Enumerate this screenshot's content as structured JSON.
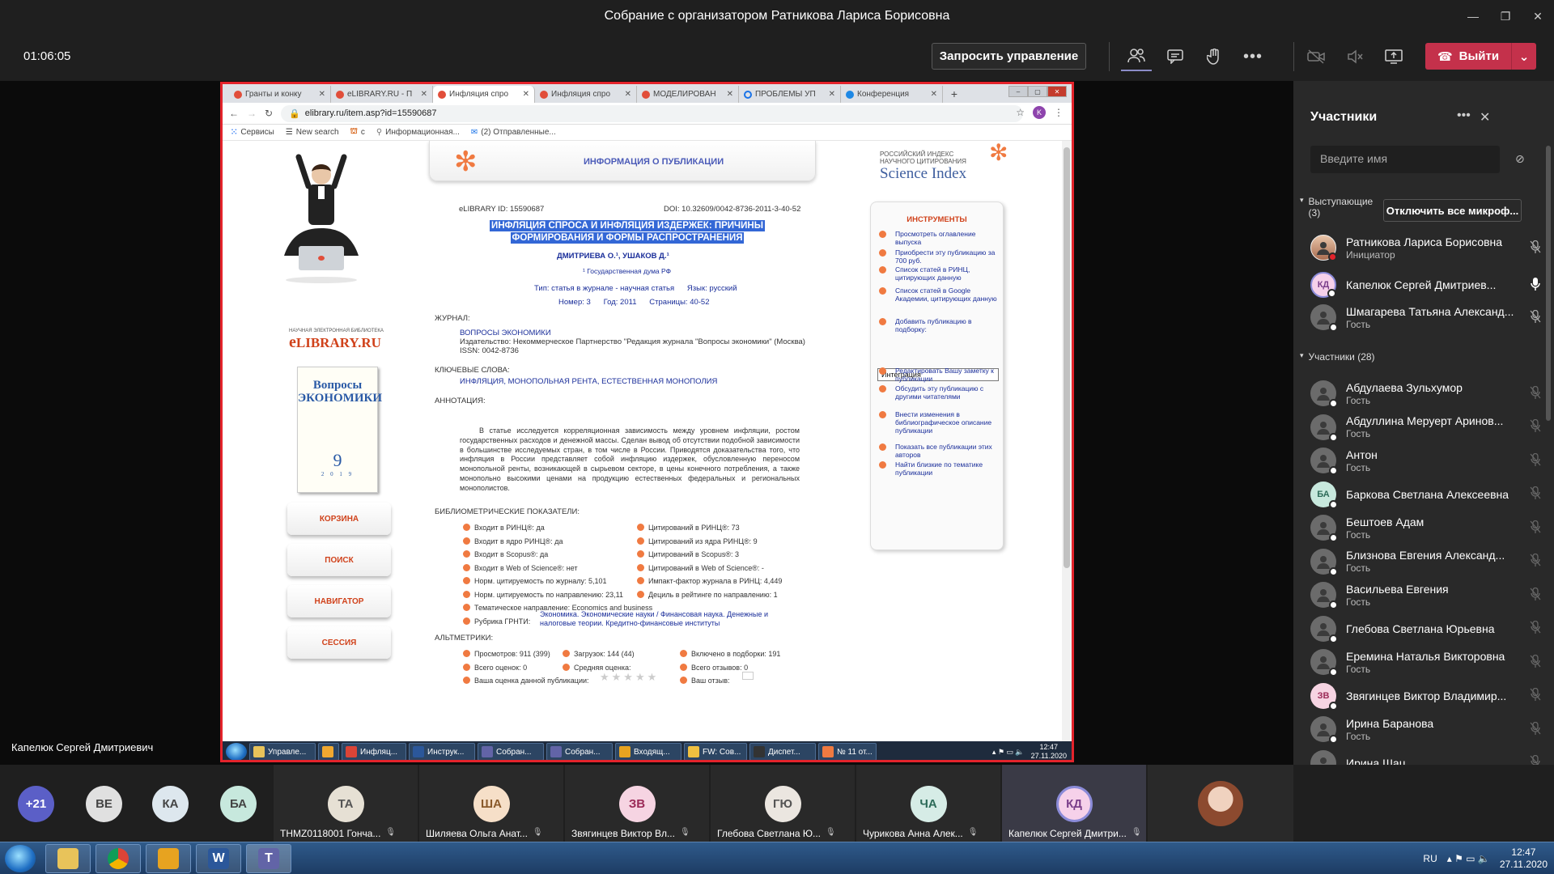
{
  "window": {
    "title": "Собрание с организатором Ратникова Лариса Борисовна"
  },
  "toolbar": {
    "timer": "01:06:05",
    "request_control": "Запросить управление",
    "leave": "Выйти"
  },
  "browser": {
    "tabs": [
      "Гранты и конку",
      "eLIBRARY.RU - П",
      "Инфляция спро",
      "Инфляция спро",
      "МОДЕЛИРОВАН",
      "ПРОБЛЕМЫ УП",
      "Конференция"
    ],
    "active_tab": 2,
    "url": "elibrary.ru/item.asp?id=15590687",
    "profile_initial": "K",
    "bookmarks": [
      "Сервисы",
      "New search",
      "с",
      "Информационная...",
      "(2) Отправленные..."
    ]
  },
  "page": {
    "header": "ИНФОРМАЦИЯ О ПУБЛИКАЦИИ",
    "elibrary_id": "eLIBRARY ID: 15590687",
    "doi": "DOI: 10.32609/0042-8736-2011-3-40-52",
    "title_line1": "ИНФЛЯЦИЯ СПРОСА И ИНФЛЯЦИЯ ИЗДЕРЖЕК: ПРИЧИНЫ",
    "title_line2": "ФОРМИРОВАНИЯ И ФОРМЫ РАСПРОСТРАНЕНИЯ",
    "authors": "ДМИТРИЕВА О.¹, УШАКОВ Д.¹",
    "affiliation": "¹ Государственная дума РФ",
    "type_line": "Тип: статья в журнале - научная статья      Язык: русский",
    "issue_line": "Номер: 3      Год: 2011      Страницы: 40-52",
    "journal_label": "ЖУРНАЛ:",
    "journal_name": "ВОПРОСЫ ЭКОНОМИКИ",
    "publisher": "Издательство: Некоммерческое Партнерство \"Редакция журнала \"Вопросы экономики\" (Москва)",
    "issn": "ISSN: 0042-8736",
    "keywords_label": "КЛЮЧЕВЫЕ СЛОВА:",
    "keywords": "ИНФЛЯЦИЯ, МОНОПОЛЬНАЯ РЕНТА, ЕСТЕСТВЕННАЯ МОНОПОЛИЯ",
    "annotation_label": "АННОТАЦИЯ:",
    "annotation": "В статье исследуется корреляционная зависимость между уровнем инфляции, ростом государственных расходов и денежной массы. Сделан вывод об отсутствии подобной зависимости в большинстве исследуемых стран, в том числе в России. Приводятся доказательства того, что инфляция в России представляет собой инфляцию издержек, обусловленную переносом монопольной ренты, возникающей в сырьевом секторе, в цены конечного потребления, а также монопольно высокими ценами на продукцию естественных федеральных и региональных монополистов.",
    "biblio_label": "БИБЛИОМЕТРИЧЕСКИЕ ПОКАЗАТЕЛИ:",
    "biblio_left": [
      "Входит в РИНЦ®: да",
      "Входит в ядро РИНЦ®: да",
      "Входит в Scopus®: да",
      "Входит в Web of Science®: нет",
      "Норм. цитируемость по журналу: 5,101",
      "Норм. цитируемость по направлению: 23,11",
      "Тематическое направление: Economics and business",
      "Рубрика ГРНТИ:"
    ],
    "biblio_right": [
      "Цитирований в РИНЦ®: 73",
      "Цитирований из ядра РИНЦ®: 9",
      "Цитирований в Scopus®: 3",
      "Цитирований в Web of Science®: -",
      "Импакт-фактор журнала в РИНЦ: 4,449",
      "Дециль в рейтинге по направлению: 1"
    ],
    "grnti": "Экономика. Экономические науки / Финансовая наука. Денежные и налоговые теории. Кредитно-финансовые институты",
    "alt_label": "АЛЬТМЕТРИКИ:",
    "alt_c1": [
      "Просмотров: 911 (399)",
      "Всего оценок: 0",
      "Ваша оценка данной публикации:"
    ],
    "alt_c2": [
      "Загрузок: 144 (44)",
      "Средняя оценка:"
    ],
    "alt_c3": [
      "Включено в подборки: 191",
      "Всего отзывов: 0",
      "Ваш отзыв:"
    ],
    "left_nav": [
      "КОРЗИНА",
      "ПОИСК",
      "НАВИГАТОР",
      "СЕССИЯ"
    ],
    "cover_title": "Вопросы ЭКОНОМИКИ",
    "cover_number": "9",
    "cover_year": "2 0 1 9",
    "logo_caption": "НАУЧНАЯ ЭЛЕКТРОННАЯ БИБЛИОТЕКА",
    "logo_text": "LIBRARY.RU",
    "si_caption1": "РОССИЙСКИЙ ИНДЕКС",
    "si_caption2": "НАУЧНОГО ЦИТИРОВАНИЯ",
    "si_text": "Science Index",
    "tools_title": "ИНСТРУМЕНТЫ",
    "tools": [
      "Просмотреть оглавление выпуска",
      "Приобрести эту публикацию за 700 руб.",
      "Список статей в РИНЦ, цитирующих данную",
      "Список статей в Google Академии, цитирующих данную",
      "Добавить публикацию в подборку:",
      "Редактировать Вашу заметку к публикации",
      "Обсудить эту публикацию с другими читателями",
      "Внести изменения в библиографическое описание публикации",
      "Показать все публикации этих авторов",
      "Найти близкие по тематике публикации"
    ],
    "select_value": "Интеграция"
  },
  "inner_taskbar": {
    "items": [
      "Управле...",
      "",
      "Инфляц...",
      "Инструк...",
      "Собран...",
      "Собран...",
      "Входящ...",
      "FW: Сов...",
      "Диспет...",
      "№ 11 от..."
    ],
    "time": "12:47",
    "date": "27.11.2020"
  },
  "presenter_label": "Капелюк Сергей Дмитриевич",
  "roster": {
    "title": "Участники",
    "search_placeholder": "Введите имя",
    "speakers_label": "Выступающие",
    "speakers_count": "(3)",
    "mute_all": "Отключить все микроф...",
    "speakers": [
      {
        "name": "Ратникова Лариса Борисовна",
        "role": "Инициатор",
        "initials": ""
      },
      {
        "name": "Капелюк Сергей Дмитриев...",
        "role": "",
        "initials": "КД"
      },
      {
        "name": "Шмагарева Татьяна Александ...",
        "role": "Гость",
        "initials": ""
      }
    ],
    "participants_label": "Участники (28)",
    "participants": [
      {
        "name": "Абдулаева Зульхумор",
        "role": "Гость",
        "initials": ""
      },
      {
        "name": "Абдуллина Меруерт Аринов...",
        "role": "Гость",
        "initials": ""
      },
      {
        "name": "Антон",
        "role": "Гость",
        "initials": ""
      },
      {
        "name": "Баркова Светлана Алексеевна",
        "role": "",
        "initials": "БА"
      },
      {
        "name": "Бештоев Адам",
        "role": "Гость",
        "initials": ""
      },
      {
        "name": "Близнова Евгения Александ...",
        "role": "Гость",
        "initials": ""
      },
      {
        "name": "Васильева Евгения",
        "role": "Гость",
        "initials": ""
      },
      {
        "name": "Глебова Светлана Юрьевна",
        "role": "",
        "initials": ""
      },
      {
        "name": "Еремина Наталья Викторовна",
        "role": "Гость",
        "initials": ""
      },
      {
        "name": "Звягинцев Виктор Владимир...",
        "role": "",
        "initials": "ЗВ"
      },
      {
        "name": "Ирина Баранова",
        "role": "Гость",
        "initials": ""
      },
      {
        "name": "Ирина Шац",
        "role": "",
        "initials": ""
      }
    ]
  },
  "gallery": {
    "bubbles": [
      "+21",
      "ВЕ",
      "КА",
      "БА"
    ],
    "tiles": [
      {
        "initials": "ТА",
        "name": "THMZ0118001 Гонча..."
      },
      {
        "initials": "ША",
        "name": "Шиляева Ольга Анат..."
      },
      {
        "initials": "ЗВ",
        "name": "Звягинцев Виктор Вл..."
      },
      {
        "initials": "ГЮ",
        "name": "Глебова Светлана Ю..."
      },
      {
        "initials": "ЧА",
        "name": "Чурикова Анна Алек..."
      },
      {
        "initials": "КД",
        "name": "Капелюк Сергей Дмитри..."
      }
    ]
  },
  "taskbar": {
    "lang": "RU",
    "time": "12:47",
    "date": "27.11.2020"
  },
  "colors": {
    "teams_bg": "#1f1f1f",
    "panel": "#292929",
    "leave": "#c4314b",
    "share_border": "#e3232b",
    "elibrary_accent": "#d0421b"
  }
}
